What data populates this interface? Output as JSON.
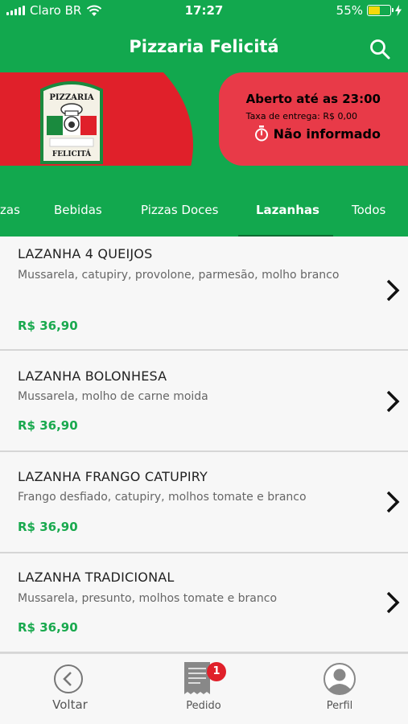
{
  "status_bar": {
    "carrier": "Claro BR",
    "time": "17:27",
    "battery_percent": "55%",
    "battery_level": 0.55,
    "icons": [
      "signal-icon",
      "wifi-icon",
      "battery-icon",
      "charging-icon"
    ]
  },
  "header": {
    "title": "Pizzaria Felicitá",
    "search_icon": "search-icon"
  },
  "banner": {
    "logo_text_top": "PIZZARIA",
    "logo_text_bottom": "FELICITÁ",
    "open_until": "Aberto até as 23:00",
    "delivery_fee": "Taxa de entrega: R$ 0,00",
    "delivery_time": "Não informado",
    "timer_icon": "stopwatch-icon"
  },
  "tabs": [
    {
      "label": "zas",
      "active": false
    },
    {
      "label": "Bebidas",
      "active": false
    },
    {
      "label": "Pizzas Doces",
      "active": false
    },
    {
      "label": "Lazanhas",
      "active": true
    },
    {
      "label": "Todos",
      "active": false
    }
  ],
  "items": [
    {
      "name": "LAZANHA 4 QUEIJOS",
      "description": "Mussarela, catupiry, provolone, parmesão, molho branco",
      "price": "R$ 36,90"
    },
    {
      "name": "LAZANHA BOLONHESA",
      "description": "Mussarela, molho de carne moida",
      "price": "R$ 36,90"
    },
    {
      "name": "LAZANHA FRANGO CATUPIRY",
      "description": "Frango desfiado, catupiry, molhos tomate e branco",
      "price": "R$ 36,90"
    },
    {
      "name": "LAZANHA TRADICIONAL",
      "description": "Mussarela, presunto, molhos tomate e branco",
      "price": "R$ 36,90"
    }
  ],
  "bottom_nav": {
    "back_label": "Voltar",
    "order_label": "Pedido",
    "order_badge": "1",
    "profile_label": "Perfil"
  },
  "colors": {
    "primary_green": "#12a84e",
    "brand_red": "#e0202a",
    "price_green": "#19a94e"
  }
}
